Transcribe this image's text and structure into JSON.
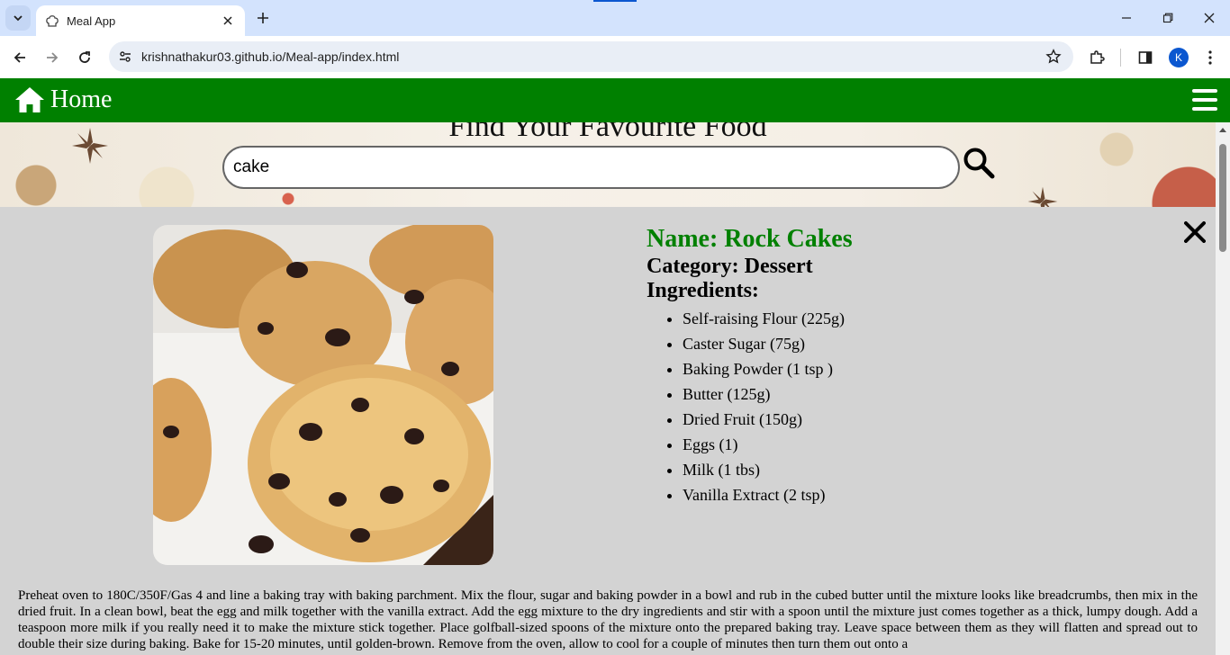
{
  "browser": {
    "tab_title": "Meal App",
    "url": "krishnathakur03.github.io/Meal-app/index.html",
    "profile_initial": "K"
  },
  "navbar": {
    "home_label": "Home",
    "color": "#008000"
  },
  "hero": {
    "title": "Find Your Favourite Food",
    "search_value": "cake"
  },
  "meal": {
    "name": "Name: Rock Cakes",
    "category": "Category: Dessert",
    "ingredients_title": "Ingredients:",
    "ingredients": [
      "Self-raising Flour (225g)",
      "Caster Sugar (75g)",
      "Baking Powder (1 tsp )",
      "Butter (125g)",
      "Dried Fruit (150g)",
      "Eggs (1)",
      "Milk (1 tbs)",
      "Vanilla Extract (2 tsp)"
    ],
    "instructions": "Preheat oven to 180C/350F/Gas 4 and line a baking tray with baking parchment. Mix the flour, sugar and baking powder in a bowl and rub in the cubed butter until the mixture looks like breadcrumbs, then mix in the dried fruit. In a clean bowl, beat the egg and milk together with the vanilla extract. Add the egg mixture to the dry ingredients and stir with a spoon until the mixture just comes together as a thick, lumpy dough. Add a teaspoon more milk if you really need it to make the mixture stick together. Place golfball-sized spoons of the mixture onto the prepared baking tray. Leave space between them as they will flatten and spread out to double their size during baking. Bake for 15-20 minutes, until golden-brown. Remove from the oven, allow to cool for a couple of minutes then turn them out onto a"
  }
}
